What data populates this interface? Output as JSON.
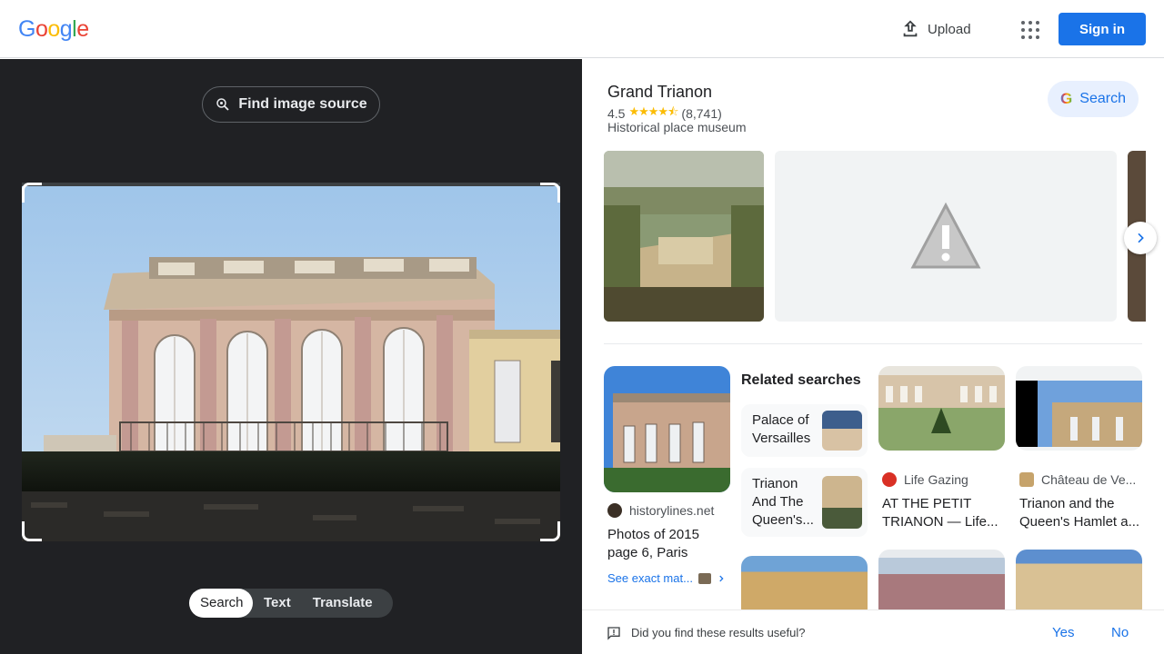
{
  "header": {
    "logo_letters": [
      "G",
      "o",
      "o",
      "g",
      "l",
      "e"
    ],
    "upload_label": "Upload",
    "signin_label": "Sign in"
  },
  "left": {
    "find_source_label": "Find image source",
    "modes": [
      "Search",
      "Text",
      "Translate"
    ],
    "active_mode": "Search"
  },
  "knowledge_panel": {
    "title": "Grand Trianon",
    "rating": "4.5",
    "stars": "★★★★⯪",
    "review_count": "(8,741)",
    "type": "Historical place museum",
    "search_label": "Search"
  },
  "results": [
    {
      "source": "historylines.net",
      "title_line1": "Photos of 2015",
      "title_line2": "page 6, Paris",
      "exact_label": "See exact mat..."
    },
    {
      "source": "Life Gazing",
      "title_line1": "AT THE PETIT",
      "title_line2": "TRIANON — Life..."
    },
    {
      "source": "Château de Ve...",
      "title_line1": "Trianon and the",
      "title_line2": "Queen's Hamlet a..."
    }
  ],
  "related": {
    "heading": "Related searches",
    "items": [
      {
        "line1": "Palace of",
        "line2": "Versailles"
      },
      {
        "line1": "Trianon",
        "line2": "And The",
        "line3": "Queen's..."
      }
    ]
  },
  "feedback": {
    "question": "Did you find these results useful?",
    "yes_label": "Yes",
    "no_label": "No"
  },
  "colors": {
    "accent": "#1a73e8",
    "left_bg": "#202124",
    "star": "#fbbc04"
  }
}
